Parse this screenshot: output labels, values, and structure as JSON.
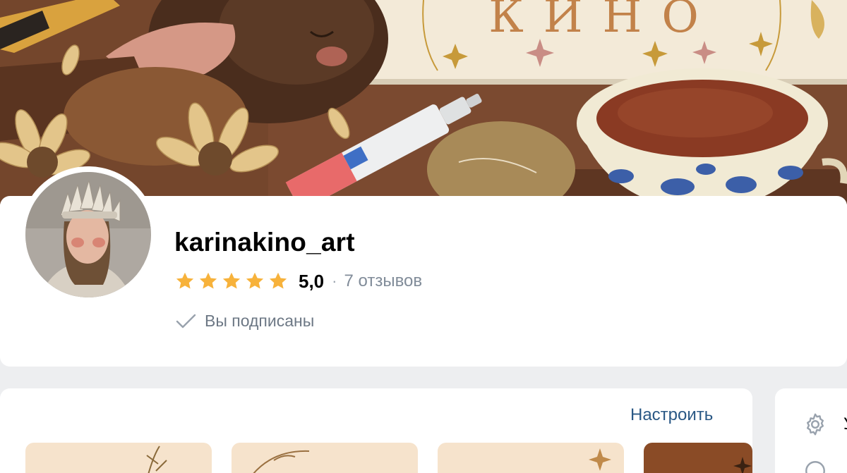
{
  "cover": {
    "title_text": "КИНО"
  },
  "profile": {
    "username": "karinakino_art",
    "rating": {
      "stars": 5,
      "max_stars": 5,
      "value": "5,0",
      "separator": "·",
      "reviews_label": "7 отзывов"
    },
    "subscription_label": "Вы подписаны"
  },
  "content": {
    "configure_label": "Настроить",
    "thumbnails": [
      "thumbnail-1",
      "thumbnail-2",
      "thumbnail-3",
      "thumbnail-4"
    ]
  },
  "sidebar": {
    "items": [
      {
        "icon": "gear-icon",
        "label": "У"
      },
      {
        "icon": "circle-icon",
        "label": ""
      }
    ]
  },
  "colors": {
    "star": "#f7b23b",
    "link": "#2a5885",
    "secondary_text": "#818c99",
    "page_background": "#edeef0"
  }
}
